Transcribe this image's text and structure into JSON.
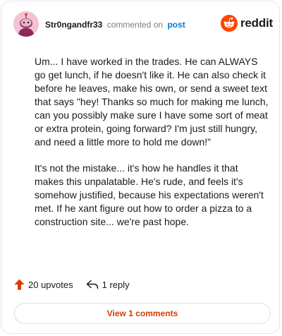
{
  "comment": {
    "username": "Str0ngandfr33",
    "commented_text": "commented on",
    "post_link": "post",
    "brand": "reddit",
    "paragraphs": [
      "Um... I have worked in the trades. He can ALWAYS go get lunch, if he doesn't like it. He can also check it before he leaves, make his own, or send a sweet text that says \"hey! Thanks so much for making me lunch, can you possibly make sure I have some sort of meat or extra protein, going forward? I'm just still hungry, and need a little more to hold me down!\"",
      "It's not the mistake... it's how he handles it that makes this unpalatable. He's rude, and feels it's somehow justified, because his expectations weren't met. If he xant figure out how to order a pizza to a construction site... we're past hope."
    ],
    "upvotes": "20 upvotes",
    "replies": "1 reply",
    "view_comments": "View 1 comments"
  },
  "icons": {
    "avatar": "avatar-icon",
    "brand": "reddit-logo-icon",
    "upvote": "upvote-arrow-icon",
    "reply": "reply-arrow-icon"
  },
  "colors": {
    "accent": "#d93a00",
    "upvote": "#d93a00",
    "link": "#0079d3",
    "reddit_orange": "#ff4500",
    "avatar_bg": "#f2c3d4"
  }
}
